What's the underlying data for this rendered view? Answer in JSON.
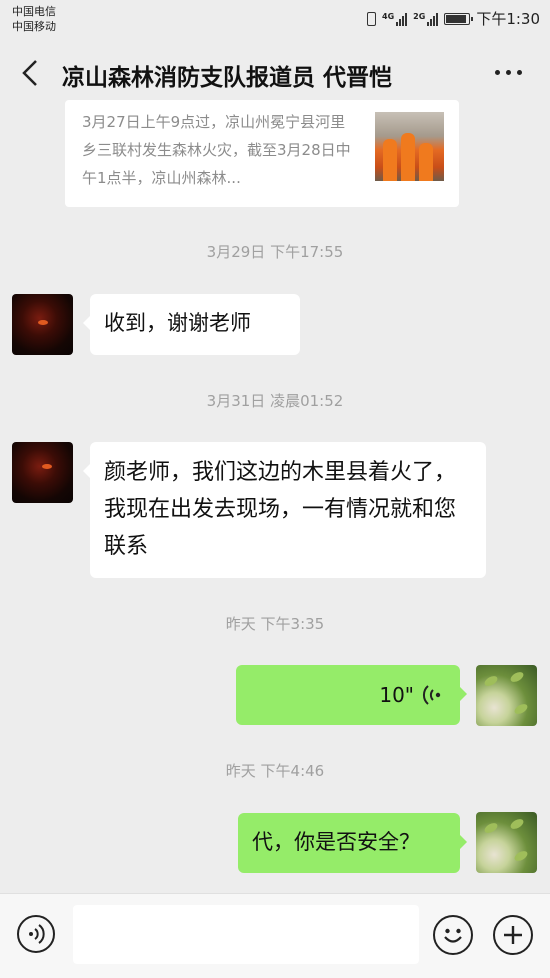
{
  "status_bar": {
    "carriers": [
      "中国电信",
      "中国移动"
    ],
    "net_1": "4G",
    "net_2": "2G",
    "time": "下午1:30"
  },
  "header": {
    "title": "凉山森林消防支队报道员 代晋恺"
  },
  "article_card": {
    "text": "3月27日上午9点过，凉山州冕宁县河里乡三联村发生森林火灾，截至3月28日中午1点半，凉山州森林..."
  },
  "messages": [
    {
      "type": "timestamp",
      "text": "3月29日 下午17:55"
    },
    {
      "type": "text",
      "side": "in",
      "text": "收到，谢谢老师"
    },
    {
      "type": "timestamp",
      "text": "3月31日 凌晨01:52"
    },
    {
      "type": "text",
      "side": "in",
      "text": "颜老师，我们这边的木里县着火了，我现在出发去现场，一有情况就和您联系"
    },
    {
      "type": "timestamp",
      "text": "昨天 下午3:35"
    },
    {
      "type": "voice",
      "side": "out",
      "text": "10\""
    },
    {
      "type": "timestamp",
      "text": "昨天 下午4:46"
    },
    {
      "type": "text",
      "side": "out",
      "text": "代，你是否安全？"
    }
  ],
  "input_bar": {
    "placeholder": ""
  },
  "icons": {
    "back": "back-arrow-icon",
    "more": "more-icon",
    "voice_toggle": "voice-input-icon",
    "emoji": "emoji-icon",
    "add": "add-icon"
  },
  "colors": {
    "background": "#ededed",
    "outgoing_bubble": "#95ec69",
    "incoming_bubble": "#ffffff",
    "timestamp_text": "#a0a0a0"
  }
}
